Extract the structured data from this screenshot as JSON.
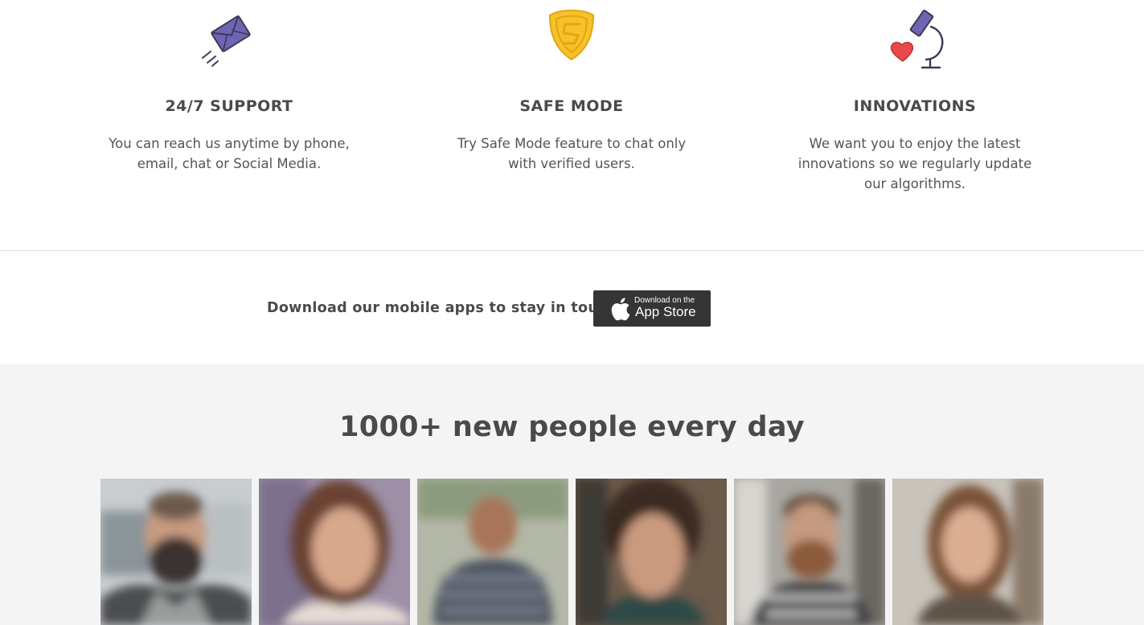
{
  "features": [
    {
      "title": "24/7 SUPPORT",
      "text": "You can reach us anytime by phone, email, chat or Social Media.",
      "icon": "envelope-icon"
    },
    {
      "title": "SAFE MODE",
      "text": "Try Safe Mode feature to chat only with verified users.",
      "icon": "shield-icon"
    },
    {
      "title": "INNOVATIONS",
      "text": "We want you to enjoy the latest innovations so we regularly update our algorithms.",
      "icon": "microscope-heart-icon"
    }
  ],
  "apps": {
    "text": "Download our mobile apps to stay in touch:",
    "appstore_small": "Download on the",
    "appstore_big": "App Store",
    "icon": "apple-icon"
  },
  "people": {
    "title": "1000+ new people every day",
    "photos": [
      "profile-photo-1",
      "profile-photo-2",
      "profile-photo-3",
      "profile-photo-4",
      "profile-photo-5",
      "profile-photo-6"
    ]
  },
  "colors": {
    "accent_purple": "#6e65b5",
    "accent_yellow": "#f5c22b",
    "heart_red": "#e84a4a",
    "dark": "#333536",
    "section_gray": "#f4f4f4"
  }
}
